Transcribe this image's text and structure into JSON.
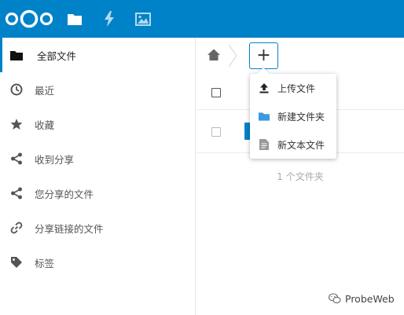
{
  "header": {
    "apps": [
      {
        "name": "files",
        "icon": "folder-icon"
      },
      {
        "name": "activity",
        "icon": "lightning-icon"
      },
      {
        "name": "gallery",
        "icon": "image-icon"
      }
    ],
    "brand_color": "#0082c9"
  },
  "sidebar": {
    "items": [
      {
        "label": "全部文件",
        "icon": "folder-icon",
        "active": true
      },
      {
        "label": "最近",
        "icon": "clock-icon"
      },
      {
        "label": "收藏",
        "icon": "star-icon"
      },
      {
        "label": "收到分享",
        "icon": "share-icon"
      },
      {
        "label": "您分享的文件",
        "icon": "share-icon"
      },
      {
        "label": "分享链接的文件",
        "icon": "link-icon"
      },
      {
        "label": "标签",
        "icon": "tag-icon"
      }
    ]
  },
  "toolbar": {
    "add_label": "+"
  },
  "new_menu": {
    "items": [
      {
        "label": "上传文件",
        "icon": "upload-icon"
      },
      {
        "label": "新建文件夹",
        "icon": "folder-icon"
      },
      {
        "label": "新文本文件",
        "icon": "text-file-icon"
      }
    ]
  },
  "file_list": {
    "summary": "1 个文件夹"
  },
  "watermark": {
    "text": "ProbeWeb"
  }
}
